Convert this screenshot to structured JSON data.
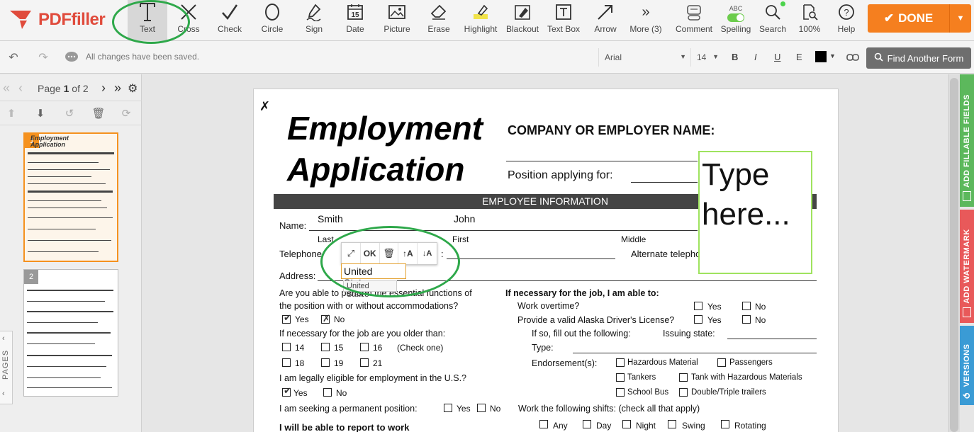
{
  "app": {
    "logo_text": "PDFfiller"
  },
  "toolbar": {
    "tools": [
      {
        "label": "Text",
        "icon": "text-icon"
      },
      {
        "label": "Cross",
        "icon": "cross-icon"
      },
      {
        "label": "Check",
        "icon": "check-icon"
      },
      {
        "label": "Circle",
        "icon": "circle-icon"
      },
      {
        "label": "Sign",
        "icon": "sign-icon"
      },
      {
        "label": "Date",
        "icon": "date-icon"
      },
      {
        "label": "Picture",
        "icon": "picture-icon"
      },
      {
        "label": "Erase",
        "icon": "erase-icon"
      },
      {
        "label": "Highlight",
        "icon": "highlight-icon"
      },
      {
        "label": "Blackout",
        "icon": "blackout-icon"
      },
      {
        "label": "Text Box",
        "icon": "text-box-icon"
      },
      {
        "label": "Arrow",
        "icon": "arrow-icon"
      },
      {
        "label": "More (3)",
        "icon": "more-icon"
      },
      {
        "label": "Comment",
        "icon": "comment-icon"
      },
      {
        "label": "Spelling",
        "icon": "spelling-icon",
        "badge": "ABC"
      },
      {
        "label": "Search",
        "icon": "search-icon"
      },
      {
        "label": "100%",
        "icon": "zoom-icon"
      },
      {
        "label": "Help",
        "icon": "help-icon"
      }
    ],
    "date_icon_text": "15",
    "done_label": "DONE",
    "active_color": "#d7d7d7",
    "done_color": "#f57f1f"
  },
  "subbar": {
    "saved_message": "All changes have been saved.",
    "font_family_value": "Arial",
    "font_size_value": "14",
    "bold": "B",
    "italic": "I",
    "underline": "U",
    "erase_format": "E",
    "find_form_label": "Find Another Form"
  },
  "pages_panel": {
    "page_label_prefix": "Page ",
    "current_page": "1",
    "page_label_of": " of ",
    "total_pages": "2",
    "tab_label": "PAGES",
    "thumbs": [
      {
        "num": "1",
        "thumb_title": "Employment\nApplication"
      },
      {
        "num": "2"
      }
    ]
  },
  "document": {
    "title_line1": "Employment",
    "title_line2": "Application",
    "company_label": "COMPANY OR EMPLOYER NAME:",
    "position_label": "Position applying for:",
    "section_title": "EMPLOYEE INFORMATION",
    "name_label": "Name:",
    "last_value": "Smith",
    "first_value": "John",
    "last_label": "Last",
    "first_label": "First",
    "middle_label": "Middle",
    "telephone_label": "Telephone",
    "alternate_label": "Alternate telephone",
    "address_label": "Address:",
    "q_perform_1": "Are you able to perform the essential functions of",
    "q_perform_2": "the position with or without accommodations?",
    "yes": "Yes",
    "no": "No",
    "q_older": "If necessary for the job are you older than:",
    "ages": [
      "14",
      "15",
      "16",
      "18",
      "19",
      "21"
    ],
    "check_one": "(Check one)",
    "q_eligible": "I am legally eligible for employment in the U.S.?",
    "q_permanent": "I am seeking a permanent position:",
    "q_report": "I will be able to report to work",
    "q_necessary": "If necessary for the job, I am able to:",
    "q_overtime": "Work overtime?",
    "q_license": "Provide a valid Alaska Driver's License?",
    "q_fill": "If so, fill out the following:",
    "issuing_state": "Issuing state:",
    "type_label": "Type:",
    "endorsements_label": "Endorsement(s):",
    "endorsements": [
      "Hazardous Material",
      "Passengers",
      "Tankers",
      "Tank with Hazardous Materials",
      "School Bus",
      "Double/Triple trailers"
    ],
    "shifts_label": "Work the following shifts: (check all that apply)",
    "shifts": [
      "Any",
      "Day",
      "Night",
      "Swing",
      "Rotating"
    ],
    "type_here": "Type here...",
    "edit_ok": "OK",
    "edit_value": "United States",
    "autocomplete_value": "United States",
    "section_color": "#444444",
    "type_box_border": "#9fe35f"
  },
  "side_tabs": [
    {
      "label": "ADD FILLABLE FIELDS",
      "color": "#5cb85c"
    },
    {
      "label": "ADD WATERMARK",
      "color": "#e8595a"
    },
    {
      "label": "VERSIONS",
      "color": "#3a9bd5"
    }
  ],
  "annotation_color": "#2ea84a"
}
